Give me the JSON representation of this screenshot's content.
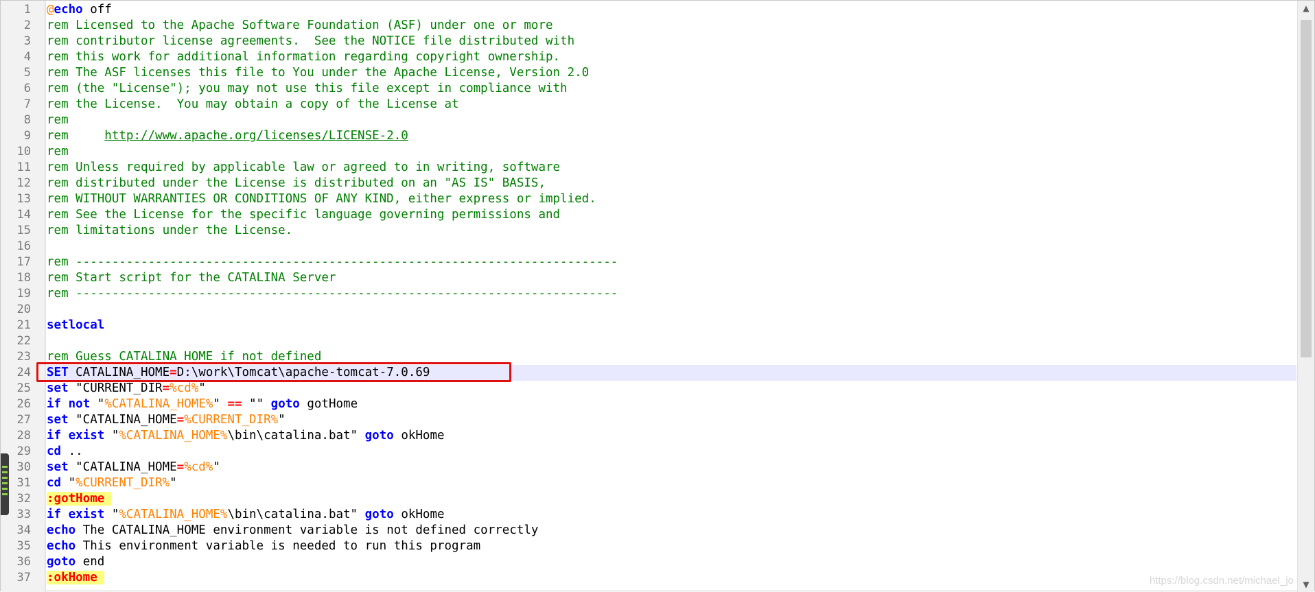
{
  "current_line": 24,
  "lines": [
    {
      "n": "1",
      "t": [
        [
          "lbl-at",
          "@"
        ],
        [
          "kw",
          "echo"
        ],
        [
          "txt",
          " off"
        ]
      ]
    },
    {
      "n": "2",
      "t": [
        [
          "cmt",
          "rem Licensed to the Apache Software Foundation (ASF) under one or more"
        ]
      ]
    },
    {
      "n": "3",
      "t": [
        [
          "cmt",
          "rem contributor license agreements.  See the NOTICE file distributed with"
        ]
      ]
    },
    {
      "n": "4",
      "t": [
        [
          "cmt",
          "rem this work for additional information regarding copyright ownership."
        ]
      ]
    },
    {
      "n": "5",
      "t": [
        [
          "cmt",
          "rem The ASF licenses this file to You under the Apache License, Version 2.0"
        ]
      ]
    },
    {
      "n": "6",
      "t": [
        [
          "cmt",
          "rem (the \"License\"); you may not use this file except in compliance with"
        ]
      ]
    },
    {
      "n": "7",
      "t": [
        [
          "cmt",
          "rem the License.  You may obtain a copy of the License at"
        ]
      ]
    },
    {
      "n": "8",
      "t": [
        [
          "cmt",
          "rem"
        ]
      ]
    },
    {
      "n": "9",
      "t": [
        [
          "cmt",
          "rem     "
        ],
        [
          "url",
          "http://www.apache.org/licenses/LICENSE-2.0"
        ]
      ]
    },
    {
      "n": "10",
      "t": [
        [
          "cmt",
          "rem"
        ]
      ]
    },
    {
      "n": "11",
      "t": [
        [
          "cmt",
          "rem Unless required by applicable law or agreed to in writing, software"
        ]
      ]
    },
    {
      "n": "12",
      "t": [
        [
          "cmt",
          "rem distributed under the License is distributed on an \"AS IS\" BASIS,"
        ]
      ]
    },
    {
      "n": "13",
      "t": [
        [
          "cmt",
          "rem WITHOUT WARRANTIES OR CONDITIONS OF ANY KIND, either express or implied."
        ]
      ]
    },
    {
      "n": "14",
      "t": [
        [
          "cmt",
          "rem See the License for the specific language governing permissions and"
        ]
      ]
    },
    {
      "n": "15",
      "t": [
        [
          "cmt",
          "rem limitations under the License."
        ]
      ]
    },
    {
      "n": "16",
      "t": []
    },
    {
      "n": "17",
      "t": [
        [
          "cmt",
          "rem ---------------------------------------------------------------------------"
        ]
      ]
    },
    {
      "n": "18",
      "t": [
        [
          "cmt",
          "rem Start script for the CATALINA Server"
        ]
      ]
    },
    {
      "n": "19",
      "t": [
        [
          "cmt",
          "rem ---------------------------------------------------------------------------"
        ]
      ]
    },
    {
      "n": "20",
      "t": []
    },
    {
      "n": "21",
      "t": [
        [
          "kw",
          "setlocal"
        ]
      ]
    },
    {
      "n": "22",
      "t": []
    },
    {
      "n": "23",
      "t": [
        [
          "cmt",
          "rem Guess CATALINA_HOME if not defined"
        ]
      ]
    },
    {
      "n": "24",
      "t": [
        [
          "kw",
          "SET"
        ],
        [
          "txt",
          " CATALINA_HOME"
        ],
        [
          "op",
          "="
        ],
        [
          "txt",
          "D:\\work\\Tomcat\\apache-tomcat-7.0.69"
        ]
      ]
    },
    {
      "n": "25",
      "t": [
        [
          "kw",
          "set"
        ],
        [
          "txt",
          " \"CURRENT_DIR"
        ],
        [
          "op",
          "="
        ],
        [
          "var",
          "%cd%"
        ],
        [
          "txt",
          "\""
        ]
      ]
    },
    {
      "n": "26",
      "t": [
        [
          "kw",
          "if"
        ],
        [
          "txt",
          " "
        ],
        [
          "kw",
          "not"
        ],
        [
          "txt",
          " \""
        ],
        [
          "var",
          "%CATALINA_HOME%"
        ],
        [
          "txt",
          "\" "
        ],
        [
          "op",
          "=="
        ],
        [
          "txt",
          " \"\" "
        ],
        [
          "kw",
          "goto"
        ],
        [
          "txt",
          " gotHome"
        ]
      ]
    },
    {
      "n": "27",
      "t": [
        [
          "kw",
          "set"
        ],
        [
          "txt",
          " \"CATALINA_HOME"
        ],
        [
          "op",
          "="
        ],
        [
          "var",
          "%CURRENT_DIR%"
        ],
        [
          "txt",
          "\""
        ]
      ]
    },
    {
      "n": "28",
      "t": [
        [
          "kw",
          "if"
        ],
        [
          "txt",
          " "
        ],
        [
          "kw",
          "exist"
        ],
        [
          "txt",
          " \""
        ],
        [
          "var",
          "%CATALINA_HOME%"
        ],
        [
          "txt",
          "\\bin\\catalina.bat\" "
        ],
        [
          "kw",
          "goto"
        ],
        [
          "txt",
          " okHome"
        ]
      ]
    },
    {
      "n": "29",
      "t": [
        [
          "kw",
          "cd"
        ],
        [
          "txt",
          " .."
        ]
      ]
    },
    {
      "n": "30",
      "t": [
        [
          "kw",
          "set"
        ],
        [
          "txt",
          " \"CATALINA_HOME"
        ],
        [
          "op",
          "="
        ],
        [
          "var",
          "%cd%"
        ],
        [
          "txt",
          "\""
        ]
      ]
    },
    {
      "n": "31",
      "t": [
        [
          "kw",
          "cd"
        ],
        [
          "txt",
          " \""
        ],
        [
          "var",
          "%CURRENT_DIR%"
        ],
        [
          "txt",
          "\""
        ]
      ]
    },
    {
      "n": "32",
      "t": [
        [
          "lbl",
          ":gotHome"
        ]
      ]
    },
    {
      "n": "33",
      "t": [
        [
          "kw",
          "if"
        ],
        [
          "txt",
          " "
        ],
        [
          "kw",
          "exist"
        ],
        [
          "txt",
          " \""
        ],
        [
          "var",
          "%CATALINA_HOME%"
        ],
        [
          "txt",
          "\\bin\\catalina.bat\" "
        ],
        [
          "kw",
          "goto"
        ],
        [
          "txt",
          " okHome"
        ]
      ]
    },
    {
      "n": "34",
      "t": [
        [
          "kw",
          "echo"
        ],
        [
          "txt",
          " The CATALINA_HOME environment variable is not defined correctly"
        ]
      ]
    },
    {
      "n": "35",
      "t": [
        [
          "kw",
          "echo"
        ],
        [
          "txt",
          " This environment variable is needed to run this program"
        ]
      ]
    },
    {
      "n": "36",
      "t": [
        [
          "kw",
          "goto"
        ],
        [
          "txt",
          " end"
        ]
      ]
    },
    {
      "n": "37",
      "t": [
        [
          "lbl",
          ":okHome"
        ]
      ]
    }
  ],
  "scrollbar": {
    "up_icon": "▲",
    "down_icon": "▼"
  },
  "watermark": "https://blog.csdn.net/michael_jo",
  "colors": {
    "comment": "#008000",
    "keyword": "#0000ff",
    "variable": "#ff8000",
    "operator": "#ff0000",
    "label_bg": "#ffff80",
    "current_line_bg": "#e8e8ff",
    "highlight_box": "#e01010"
  }
}
